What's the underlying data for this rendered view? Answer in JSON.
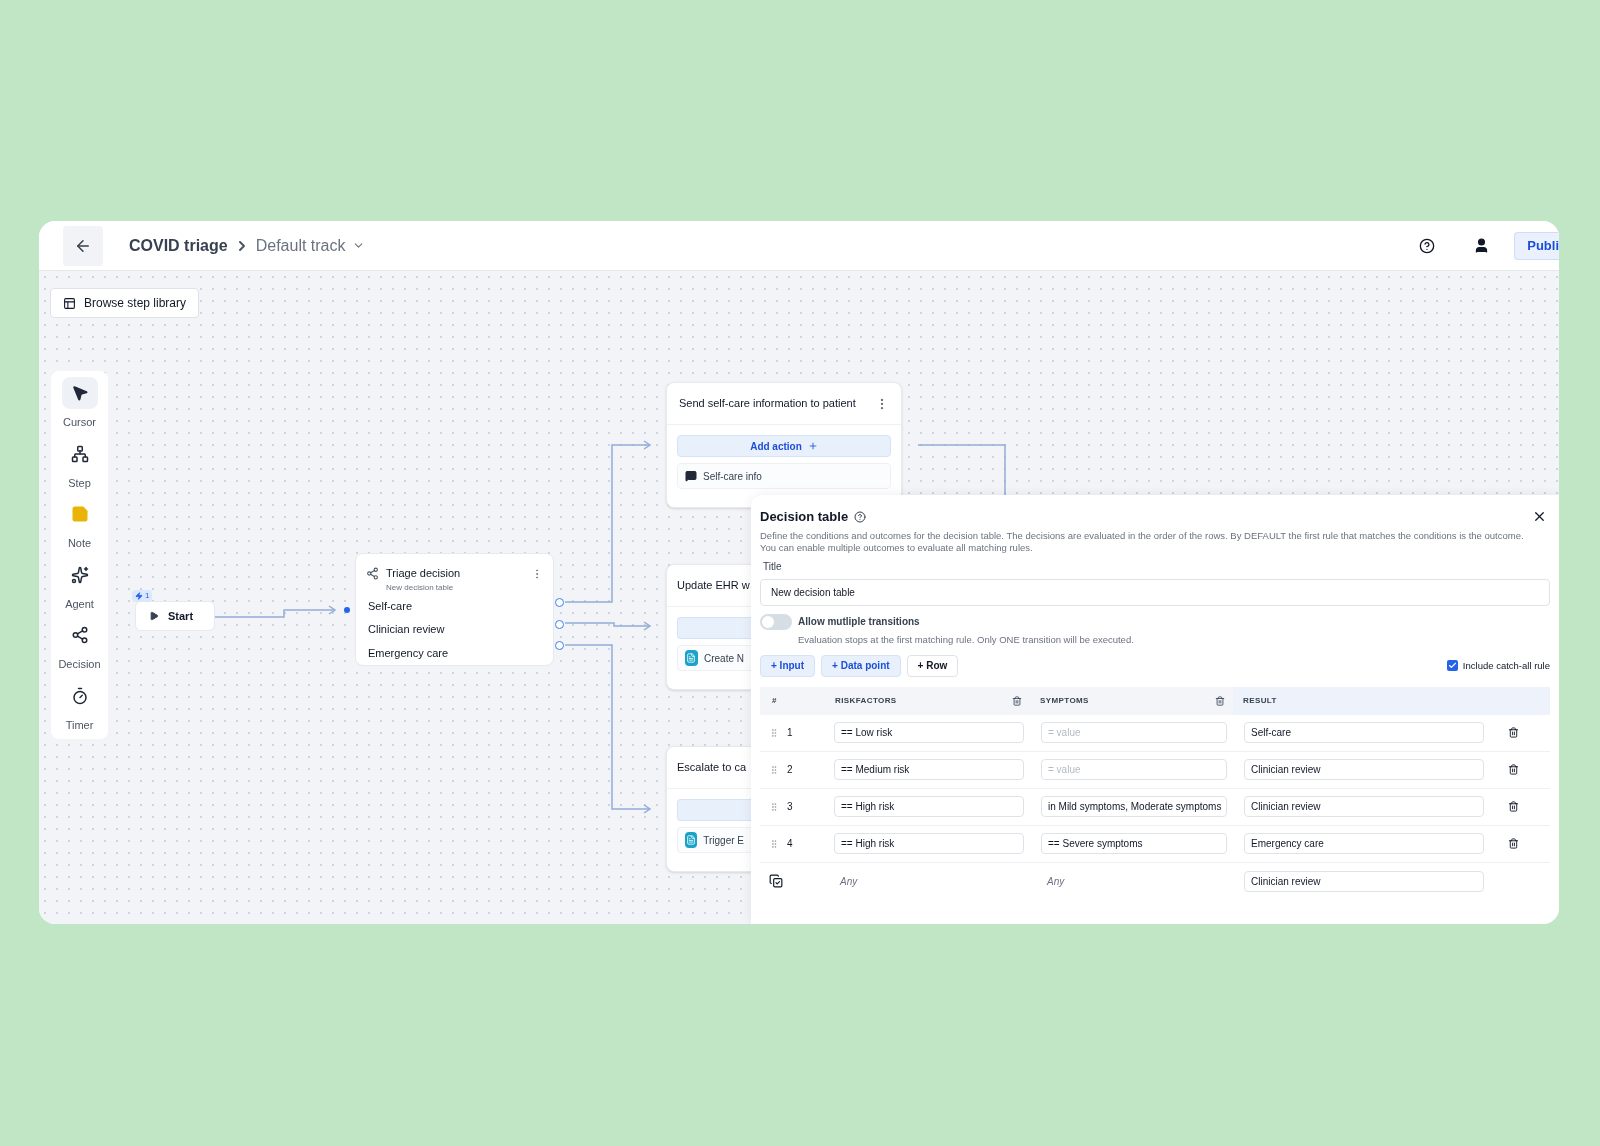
{
  "header": {
    "title": "COVID triage",
    "track": "Default track",
    "publish": "Publi"
  },
  "browse_button": "Browse step library",
  "tools": [
    {
      "kind": "cursor",
      "label": "Cursor",
      "selected": true
    },
    {
      "kind": "step",
      "label": "Step",
      "selected": false
    },
    {
      "kind": "note",
      "label": "Note",
      "selected": false
    },
    {
      "kind": "agent",
      "label": "Agent",
      "selected": false
    },
    {
      "kind": "decision",
      "label": "Decision",
      "selected": false
    },
    {
      "kind": "timer",
      "label": "Timer",
      "selected": false
    }
  ],
  "start": {
    "label": "Start",
    "badge": "1"
  },
  "triage": {
    "title": "Triage decision",
    "subtitle": "New decision table",
    "outcomes": [
      "Self-care",
      "Clinician review",
      "Emergency care"
    ]
  },
  "steps": [
    {
      "title": "Send self-care information to patient",
      "action_label": "Add action",
      "item": {
        "kind": "message",
        "label": "Self-care info"
      }
    },
    {
      "title": "Update EHR w",
      "item": {
        "kind": "app",
        "label": "Create N"
      }
    },
    {
      "title": "Escalate to ca",
      "item": {
        "kind": "app",
        "label": "Trigger E"
      }
    }
  ],
  "panel": {
    "title": "Decision table",
    "description": "Define the conditions and outcomes for the decision table. The decisions are evaluated in the order of the rows. By DEFAULT the first rule that matches the conditions is the outcome. You can enable multiple outcomes to evaluate all matching rules.",
    "title_label": "Title",
    "title_value": "New decision table",
    "toggle": {
      "label": "Allow mutliple transitions",
      "on": false,
      "hint": "Evaluation stops at the first matching rule. Only ONE transition will be executed."
    },
    "buttons": [
      {
        "label": "+ Input",
        "kind": "tinted"
      },
      {
        "label": "+ Data point",
        "kind": "tinted"
      },
      {
        "label": "+ Row",
        "kind": "plain"
      }
    ],
    "catch_all": {
      "label": "Include catch-all rule",
      "checked": true
    },
    "columns": [
      "#",
      "RISKFACTORS",
      "SYMPTOMS",
      "RESULT"
    ],
    "rows": [
      {
        "index": "1",
        "riskfactors": "== Low risk",
        "symptoms": {
          "placeholder": "= value"
        },
        "result": "Self-care"
      },
      {
        "index": "2",
        "riskfactors": "== Medium risk",
        "symptoms": {
          "placeholder": "= value"
        },
        "result": "Clinician review"
      },
      {
        "index": "3",
        "riskfactors": "== High risk",
        "symptoms": {
          "value": "in Mild symptoms, Moderate symptoms"
        },
        "result": "Clinician review"
      },
      {
        "index": "4",
        "riskfactors": "== High risk",
        "symptoms": {
          "value": "== Severe symptoms"
        },
        "result": "Emergency care"
      }
    ],
    "catch_all_row": {
      "riskfactors": "Any",
      "symptoms": "Any",
      "result": "Clinician review"
    }
  }
}
